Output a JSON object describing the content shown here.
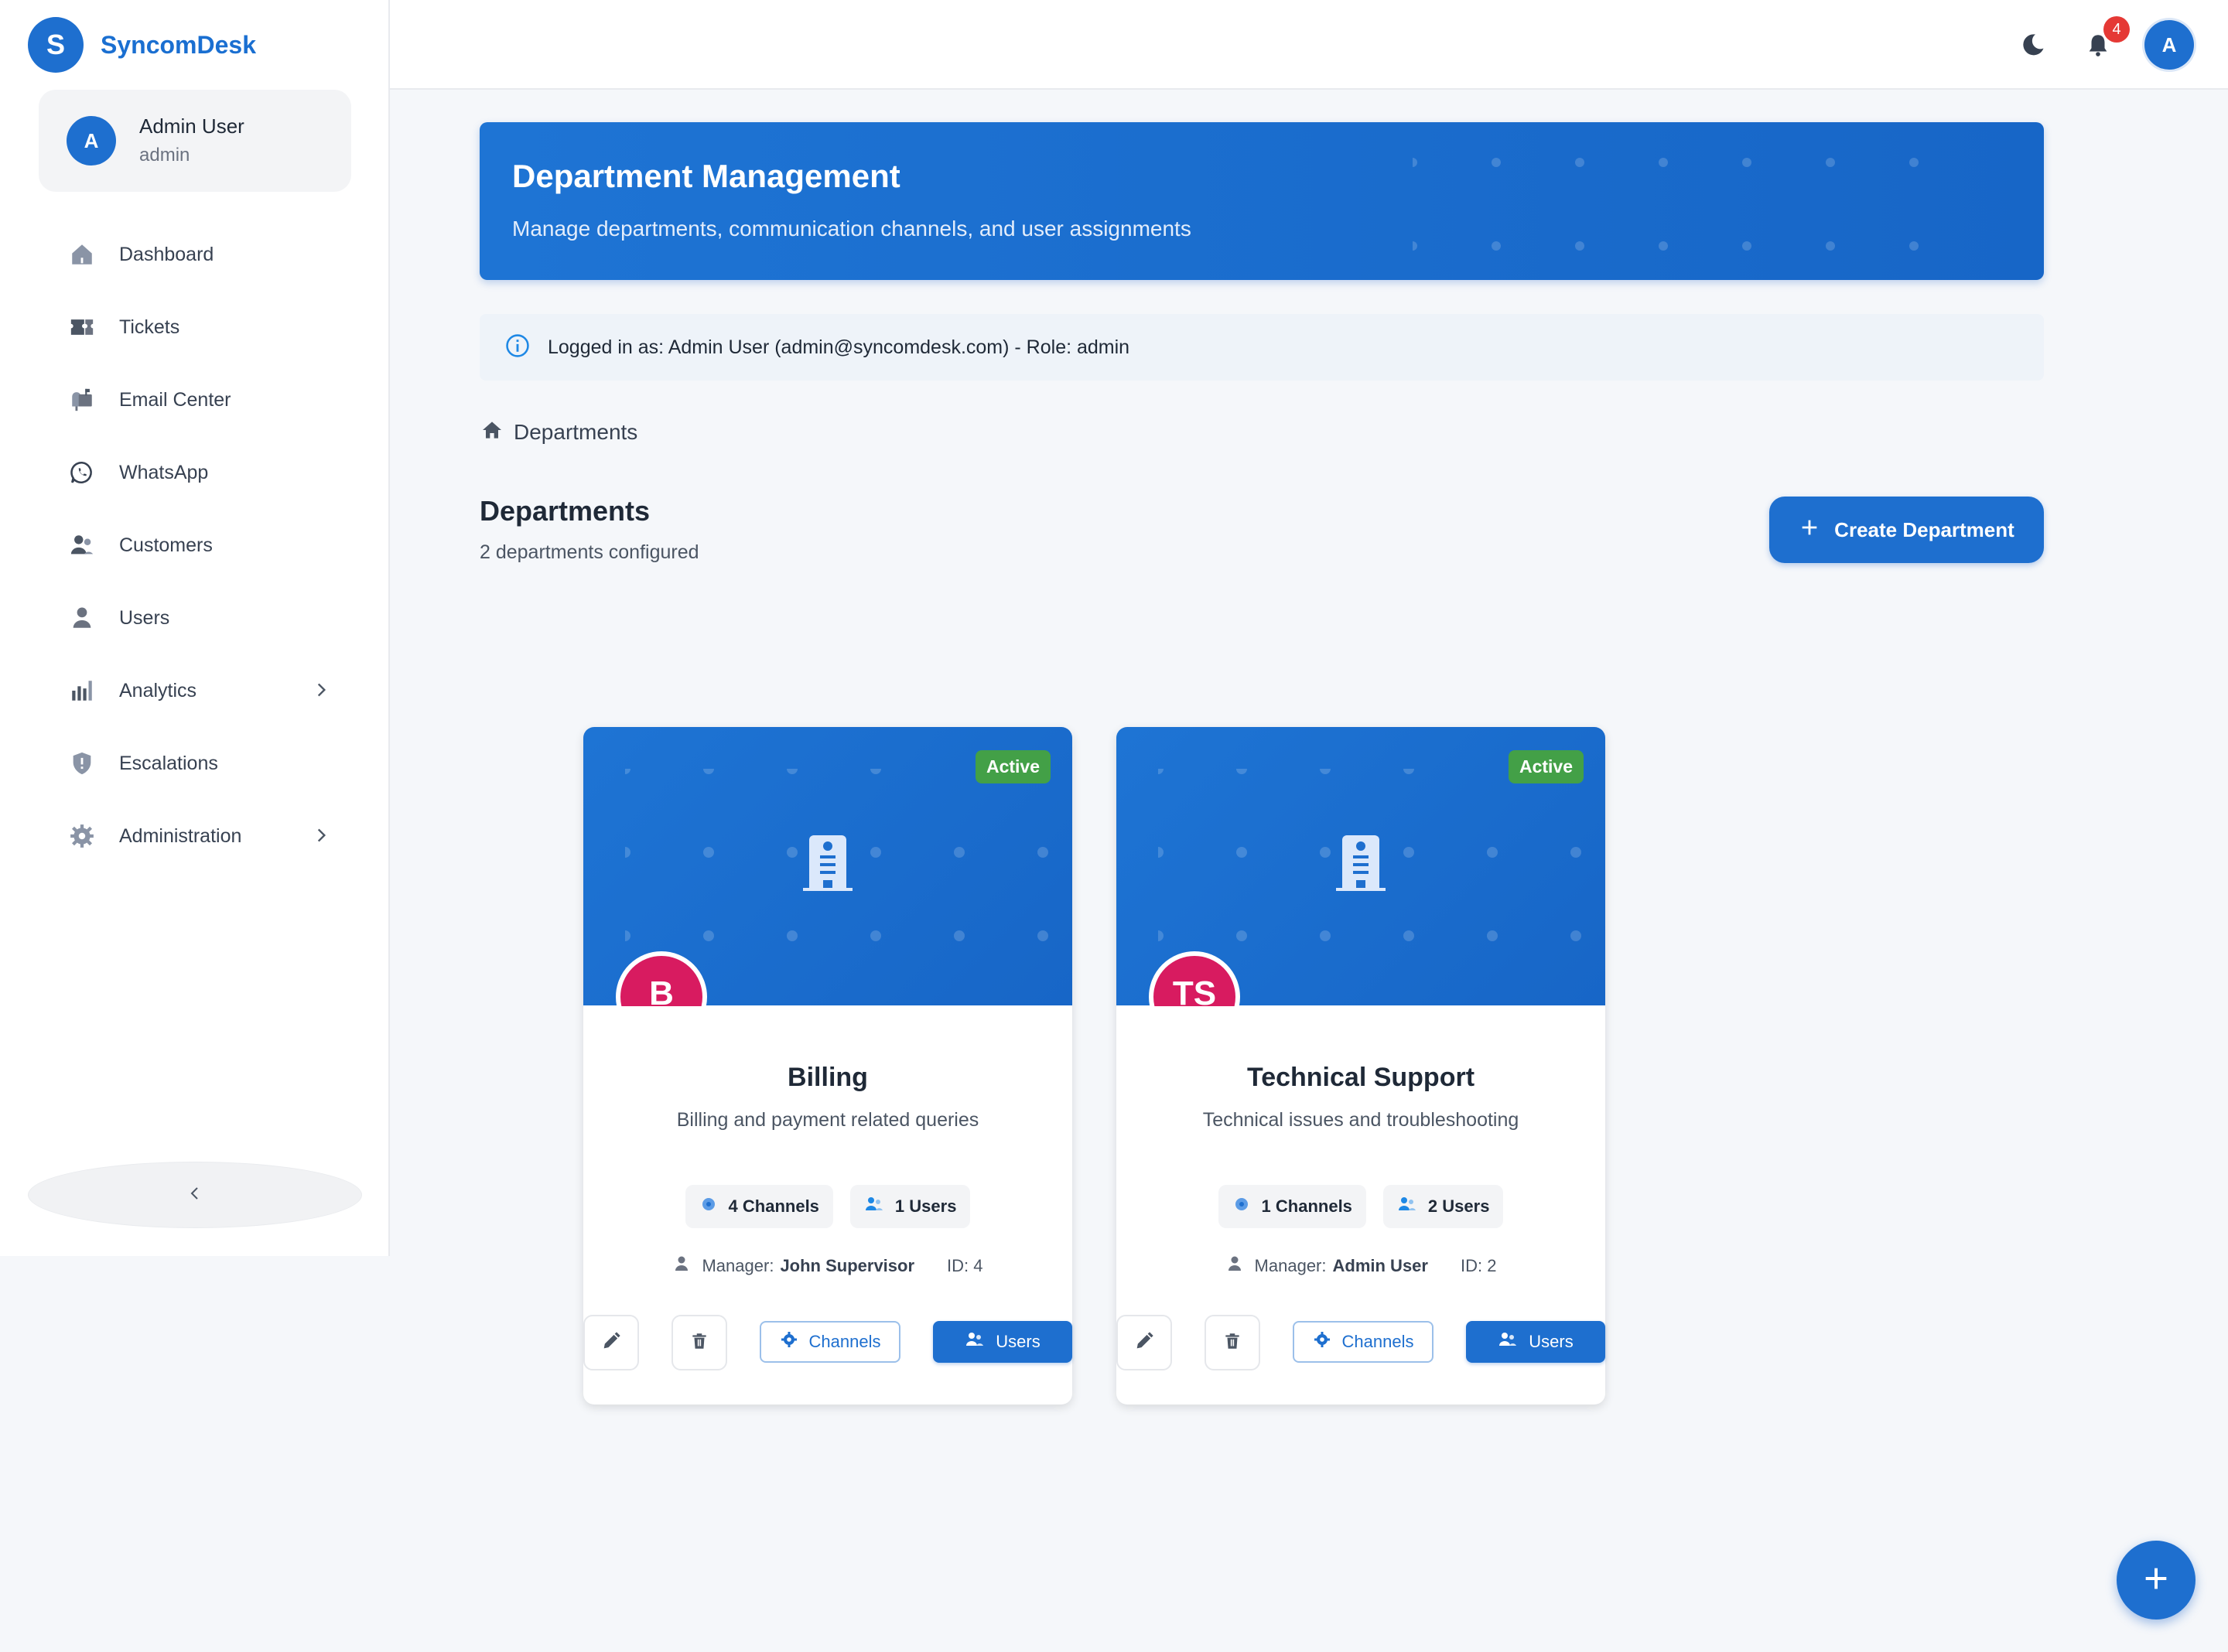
{
  "brand": {
    "logo_letter": "S",
    "name": "SyncomDesk"
  },
  "sidebar": {
    "user": {
      "initial": "A",
      "name": "Admin User",
      "role": "admin"
    },
    "items": [
      {
        "label": "Dashboard",
        "icon": "home-icon"
      },
      {
        "label": "Tickets",
        "icon": "ticket-icon"
      },
      {
        "label": "Email Center",
        "icon": "mailbox-icon"
      },
      {
        "label": "WhatsApp",
        "icon": "whatsapp-icon"
      },
      {
        "label": "Customers",
        "icon": "customers-icon"
      },
      {
        "label": "Users",
        "icon": "user-icon"
      },
      {
        "label": "Analytics",
        "icon": "bar-chart-icon",
        "expandable": true
      },
      {
        "label": "Escalations",
        "icon": "shield-alert-icon"
      },
      {
        "label": "Administration",
        "icon": "gear-icon",
        "expandable": true
      }
    ],
    "collapse_icon": "chevron-left-icon"
  },
  "topbar": {
    "theme_icon": "moon-icon",
    "notifications_icon": "bell-icon",
    "notification_count": "4",
    "avatar_initial": "A"
  },
  "hero": {
    "title": "Department Management",
    "subtitle": "Manage departments, communication channels, and user assignments"
  },
  "info": {
    "icon": "info-icon",
    "text": "Logged in as: Admin User (admin@syncomdesk.com) - Role: admin"
  },
  "breadcrumb": {
    "icon": "home-icon",
    "label": "Departments"
  },
  "section": {
    "title": "Departments",
    "subtitle": "2 departments configured",
    "create_button": "Create Department"
  },
  "departments": [
    {
      "status": "Active",
      "initials": "B",
      "name": "Billing",
      "description": "Billing and payment related queries",
      "channels_chip": "4 Channels",
      "users_chip": "1 Users",
      "manager_label": "Manager:",
      "manager_name": "John Supervisor",
      "id_text": "ID: 4",
      "channels_button": "Channels",
      "users_button": "Users"
    },
    {
      "status": "Active",
      "initials": "TS",
      "name": "Technical Support",
      "description": "Technical issues and troubleshooting",
      "channels_chip": "1 Channels",
      "users_chip": "2 Users",
      "manager_label": "Manager:",
      "manager_name": "Admin User",
      "id_text": "ID: 2",
      "channels_button": "Channels",
      "users_button": "Users"
    }
  ],
  "colors": {
    "primary": "#1e6fcf",
    "active_badge": "#43a047",
    "dept_avatar": "#d81b60",
    "notification_badge": "#e53935"
  }
}
